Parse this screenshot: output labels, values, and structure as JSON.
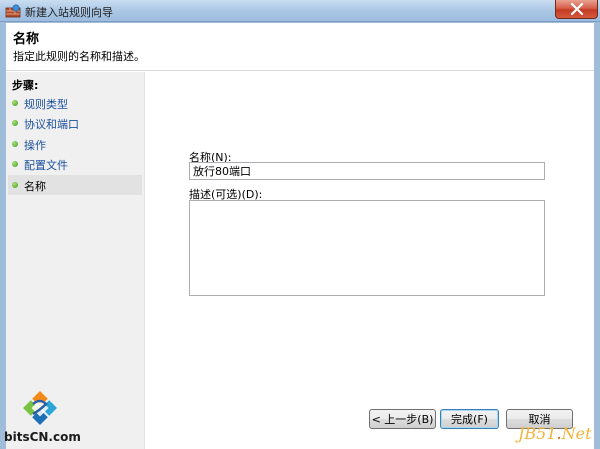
{
  "window": {
    "title": "新建入站规则向导"
  },
  "header": {
    "title": "名称",
    "description": "指定此规则的名称和描述。"
  },
  "steps": {
    "title": "步骤:",
    "items": [
      {
        "label": "规则类型",
        "current": false
      },
      {
        "label": "协议和端口",
        "current": false
      },
      {
        "label": "操作",
        "current": false
      },
      {
        "label": "配置文件",
        "current": false
      },
      {
        "label": "名称",
        "current": true
      }
    ]
  },
  "form": {
    "name_label": "名称(N):",
    "name_value": "放行80端口",
    "description_label": "描述(可选)(D):",
    "description_value": ""
  },
  "buttons": {
    "back": "< 上一步(B)",
    "finish": "完成(F)",
    "cancel": "取消"
  },
  "watermarks": {
    "left_text": "bitsCN.com",
    "right_prefix": "JB51",
    "right_dot": ".",
    "right_suffix": "Net"
  },
  "colors": {
    "titlebar": "#a9c6e4",
    "close_button": "#c23b23",
    "step_link": "#1a4f9c",
    "step_bullet": "#3f9a1c"
  }
}
